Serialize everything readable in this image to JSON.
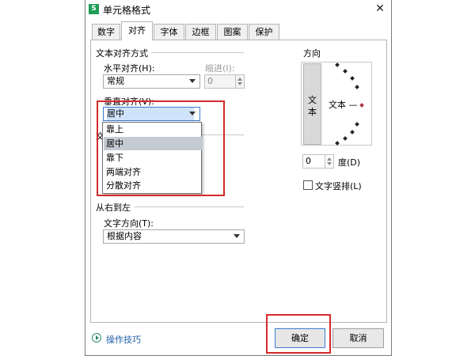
{
  "window": {
    "title": "单元格格式",
    "app_icon_letter": "S",
    "close": "✕"
  },
  "tabs": [
    {
      "label": "数字"
    },
    {
      "label": "对齐"
    },
    {
      "label": "字体"
    },
    {
      "label": "边框"
    },
    {
      "label": "图案"
    },
    {
      "label": "保护"
    }
  ],
  "text_alignment": {
    "section_label": "文本对齐方式",
    "horizontal_label": "水平对齐(H):",
    "horizontal_value": "常规",
    "indent_label": "缩进(I):",
    "indent_value": "0",
    "vertical_label": "垂直对齐(V):",
    "vertical_value": "居中",
    "vertical_options": [
      "靠上",
      "居中",
      "靠下",
      "两端对齐",
      "分散对齐"
    ],
    "vertical_selected": "居中"
  },
  "obscured_text_control": {
    "visible_char": "文"
  },
  "rtl": {
    "section_label": "从右到左",
    "direction_label": "文字方向(T):",
    "direction_value": "根据内容"
  },
  "orientation": {
    "section_label": "方向",
    "vertical_text_chars": [
      "文",
      "本"
    ],
    "horizontal_text": "文本 —",
    "degree_value": "0",
    "degree_label": "度(D)",
    "vertical_layout_label": "文字竖排(L)"
  },
  "footer": {
    "tips_label": "操作技巧",
    "ok_label": "确定",
    "cancel_label": "取消"
  },
  "colors": {
    "highlight": "#d42a2a",
    "accent": "#3a7bd5",
    "selection": "#c5cbd2"
  }
}
